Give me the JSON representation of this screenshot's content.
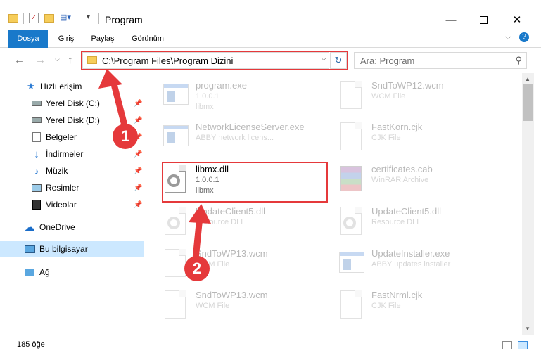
{
  "window": {
    "title": "Program",
    "minimize_icon": "minimize-icon",
    "maximize_icon": "maximize-icon",
    "close_icon": "close-icon"
  },
  "ribbon": {
    "tabs": [
      {
        "label": "Dosya",
        "active": true
      },
      {
        "label": "Giriş",
        "active": false
      },
      {
        "label": "Paylaş",
        "active": false
      },
      {
        "label": "Görünüm",
        "active": false
      }
    ]
  },
  "address": {
    "path": "C:\\Program Files\\Program Dizini"
  },
  "search": {
    "placeholder": "Ara: Program"
  },
  "sidebar": {
    "items": [
      {
        "label": "Hızlı erişim",
        "icon": "star-icon",
        "pinned": false
      },
      {
        "label": "Yerel Disk (C:)",
        "icon": "disk-icon",
        "pinned": true
      },
      {
        "label": "Yerel Disk (D:)",
        "icon": "disk-icon",
        "pinned": true
      },
      {
        "label": "Belgeler",
        "icon": "documents-icon",
        "pinned": true
      },
      {
        "label": "İndirmeler",
        "icon": "download-icon",
        "pinned": true
      },
      {
        "label": "Müzik",
        "icon": "music-icon",
        "pinned": true
      },
      {
        "label": "Resimler",
        "icon": "pictures-icon",
        "pinned": true
      },
      {
        "label": "Videolar",
        "icon": "video-icon",
        "pinned": true
      },
      {
        "label": "OneDrive",
        "icon": "cloud-icon",
        "pinned": false
      },
      {
        "label": "Bu bilgisayar",
        "icon": "computer-icon",
        "pinned": false,
        "selected": true
      },
      {
        "label": "Ağ",
        "icon": "network-icon",
        "pinned": false
      }
    ]
  },
  "files": [
    {
      "name": "program.exe",
      "line1": "1.0.0.1",
      "line2": "libmx",
      "icon": "program-icon"
    },
    {
      "name": "SndToWP12.wcm",
      "line1": "WCM File",
      "line2": "",
      "icon": "document-icon"
    },
    {
      "name": "NetworkLicenseServer.exe",
      "line1": "ABBY network licens...",
      "line2": "",
      "icon": "exe-icon"
    },
    {
      "name": "FastKorn.cjk",
      "line1": "CJK File",
      "line2": "",
      "icon": "document-icon"
    },
    {
      "name": "libmx.dll",
      "line1": "1.0.0.1",
      "line2": "libmx",
      "icon": "dll-gear-icon"
    },
    {
      "name": "certificates.cab",
      "line1": "WinRAR Archive",
      "line2": "",
      "icon": "winrar-icon"
    },
    {
      "name": "UpdateClient5.dll",
      "line1": "Resource DLL",
      "line2": "",
      "icon": "dll-gear-icon"
    },
    {
      "name": "UpdateClient5.dll",
      "line1": "Resource DLL",
      "line2": "",
      "icon": "dll-gear-icon"
    },
    {
      "name": "SndToWP13.wcm",
      "line1": "WCM File",
      "line2": "",
      "icon": "document-icon"
    },
    {
      "name": "UpdateInstaller.exe",
      "line1": "ABBY updates installer",
      "line2": "",
      "icon": "exe-icon"
    },
    {
      "name": "SndToWP13.wcm",
      "line1": "WCM File",
      "line2": "",
      "icon": "document-icon"
    },
    {
      "name": "FastNrml.cjk",
      "line1": "CJK File",
      "line2": "",
      "icon": "document-icon"
    }
  ],
  "status": {
    "count": "185 öğe"
  },
  "annotations": {
    "badge1": "1",
    "badge2": "2"
  },
  "colors": {
    "accent": "#1979ca",
    "highlight": "#e5393b",
    "selected": "#cce8ff"
  }
}
